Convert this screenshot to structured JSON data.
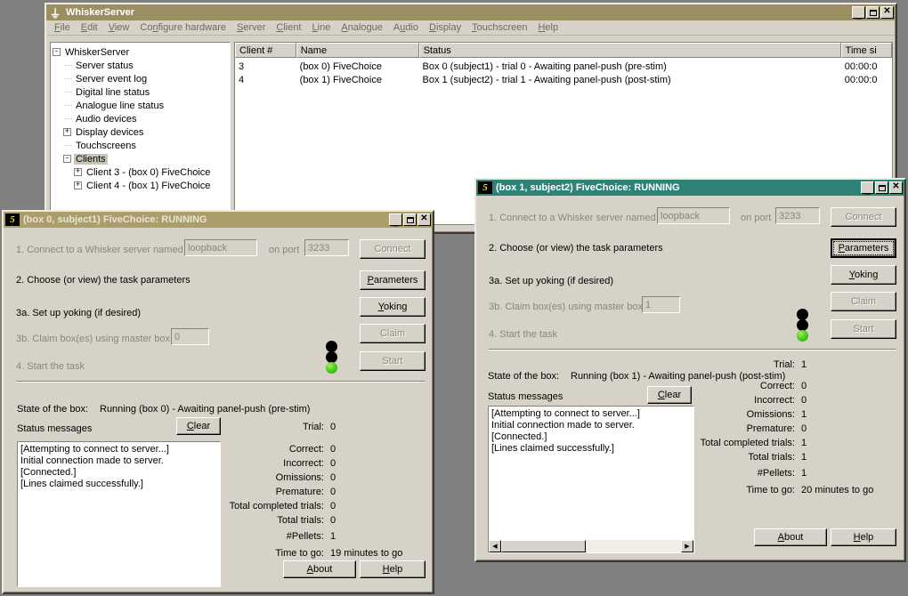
{
  "desktop": {
    "background": "#808080"
  },
  "server_window": {
    "title": "WhiskerServer",
    "icon": "whisker-icon",
    "titlebar_buttons": {
      "minimize": "_",
      "maximize": "□",
      "close": "✕"
    },
    "menu": [
      {
        "label": "File",
        "accel": "F"
      },
      {
        "label": "Edit",
        "accel": "E"
      },
      {
        "label": "View",
        "accel": "V"
      },
      {
        "label": "Configure hardware",
        "accel": "n"
      },
      {
        "label": "Server",
        "accel": "S"
      },
      {
        "label": "Client",
        "accel": "C"
      },
      {
        "label": "Line",
        "accel": "L"
      },
      {
        "label": "Analogue",
        "accel": "A"
      },
      {
        "label": "Audio",
        "accel": "u"
      },
      {
        "label": "Display",
        "accel": "D"
      },
      {
        "label": "Touchscreen",
        "accel": "T"
      },
      {
        "label": "Help",
        "accel": "H"
      }
    ],
    "tree": [
      {
        "label": "WhiskerServer",
        "depth": 0,
        "expander": "-",
        "selected": false
      },
      {
        "label": "Server status",
        "depth": 1,
        "expander": "",
        "selected": false
      },
      {
        "label": "Server event log",
        "depth": 1,
        "expander": "",
        "selected": false
      },
      {
        "label": "Digital line status",
        "depth": 1,
        "expander": "",
        "selected": false
      },
      {
        "label": "Analogue line status",
        "depth": 1,
        "expander": "",
        "selected": false
      },
      {
        "label": "Audio devices",
        "depth": 1,
        "expander": "",
        "selected": false
      },
      {
        "label": "Display devices",
        "depth": 1,
        "expander": "+",
        "selected": false
      },
      {
        "label": "Touchscreens",
        "depth": 1,
        "expander": "",
        "selected": false
      },
      {
        "label": "Clients",
        "depth": 1,
        "expander": "-",
        "selected": true
      },
      {
        "label": "Client 3 - (box 0) FiveChoice",
        "depth": 2,
        "expander": "+",
        "selected": false
      },
      {
        "label": "Client 4 - (box 1) FiveChoice",
        "depth": 2,
        "expander": "+",
        "selected": false
      }
    ],
    "list": {
      "columns": [
        "Client #",
        "Name",
        "Status",
        "Time si"
      ],
      "rows": [
        {
          "client": "3",
          "name": "(box 0) FiveChoice",
          "status": "Box 0 (subject1) - trial 0 - Awaiting panel-push (pre-stim)",
          "time": "00:00:0"
        },
        {
          "client": "4",
          "name": "(box 1) FiveChoice",
          "status": "Box 1 (subject2) - trial 1 - Awaiting panel-push (post-stim)",
          "time": "00:00:0"
        }
      ]
    }
  },
  "box0": {
    "title": "(box 0, subject1) FiveChoice: RUNNING",
    "icon": "five-choice-icon",
    "active": false,
    "titlebar_buttons": {
      "minimize": "_",
      "maximize": "□",
      "close": "✕"
    },
    "step1_label": "1. Connect to a Whisker server named",
    "server_name": "loopback",
    "port_label": "on port",
    "port_value": "3233",
    "connect_button": "Connect",
    "step2_label": "2. Choose (or view) the task parameters",
    "parameters_button": "Parameters",
    "step3a_label": "3a. Set up yoking (if desired)",
    "yoking_button": "Yoking",
    "step3b_label": "3b. Claim box(es) using master box",
    "master_box": "0",
    "claim_button": "Claim",
    "step4_label": "4. Start the task",
    "start_button": "Start",
    "lights": [
      "off",
      "off",
      "green"
    ],
    "state_label": "State of the box:",
    "state_value": "Running (box 0) - Awaiting panel-push (pre-stim)",
    "status_messages_label": "Status messages",
    "clear_button": "Clear",
    "messages": [
      "[Attempting to connect to server...]",
      "Initial connection made to server.",
      "[Connected.]",
      "[Lines claimed successfully.]"
    ],
    "has_hscroll": false,
    "stats": [
      {
        "label": "Trial:",
        "value": "0"
      },
      {
        "label": "Correct:",
        "value": "0"
      },
      {
        "label": "Incorrect:",
        "value": "0"
      },
      {
        "label": "Omissions:",
        "value": "0"
      },
      {
        "label": "Premature:",
        "value": "0"
      },
      {
        "label": "Total completed trials:",
        "value": "0"
      },
      {
        "label": "Total trials:",
        "value": "0"
      },
      {
        "label": "#Pellets:",
        "value": "1"
      },
      {
        "label": "Time to go:",
        "value": "19 minutes to go"
      }
    ],
    "about_button": "About",
    "help_button": "Help"
  },
  "box1": {
    "title": "(box 1, subject2) FiveChoice: RUNNING",
    "icon": "five-choice-icon",
    "active": true,
    "titlebar_buttons": {
      "minimize": "_",
      "maximize": "□",
      "close": "✕"
    },
    "step1_label": "1. Connect to a Whisker server named",
    "server_name": "loopback",
    "port_label": "on port",
    "port_value": "3233",
    "connect_button": "Connect",
    "step2_label": "2. Choose (or view) the task parameters",
    "parameters_button": "Parameters",
    "step3a_label": "3a. Set up yoking (if desired)",
    "yoking_button": "Yoking",
    "step3b_label": "3b. Claim box(es) using master box",
    "master_box": "1",
    "claim_button": "Claim",
    "step4_label": "4. Start the task",
    "start_button": "Start",
    "lights": [
      "off",
      "off",
      "green"
    ],
    "state_label": "State of the box:",
    "state_value": "Running (box 1) - Awaiting panel-push (post-stim)",
    "status_messages_label": "Status messages",
    "clear_button": "Clear",
    "messages": [
      "[Attempting to connect to server...]",
      "Initial connection made to server.",
      "[Connected.]",
      "[Lines claimed successfully.]"
    ],
    "has_hscroll": true,
    "stats": [
      {
        "label": "Trial:",
        "value": "1"
      },
      {
        "label": "Correct:",
        "value": "0"
      },
      {
        "label": "Incorrect:",
        "value": "0"
      },
      {
        "label": "Omissions:",
        "value": "1"
      },
      {
        "label": "Premature:",
        "value": "0"
      },
      {
        "label": "Total completed trials:",
        "value": "1"
      },
      {
        "label": "Total trials:",
        "value": "1"
      },
      {
        "label": "#Pellets:",
        "value": "1"
      },
      {
        "label": "Time to go:",
        "value": "20 minutes to go"
      }
    ],
    "about_button": "About",
    "help_button": "Help"
  }
}
